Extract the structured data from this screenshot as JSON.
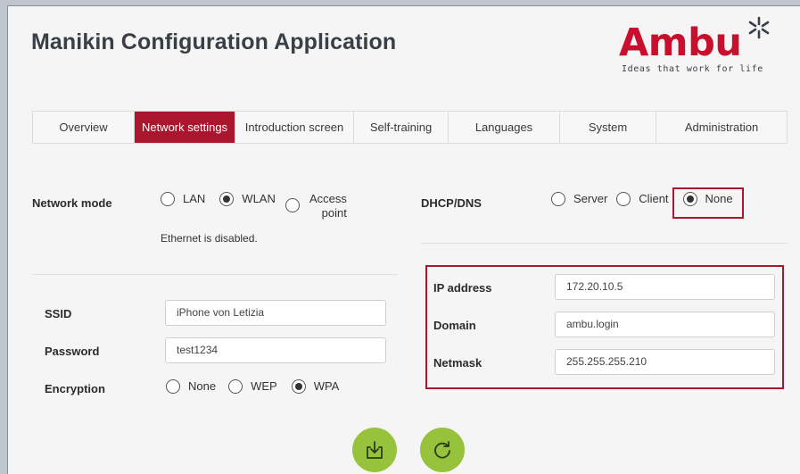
{
  "app": {
    "title": "Manikin Configuration Application",
    "brand": "Ambu",
    "tagline": "Ideas that work for life",
    "accent_color": "#a9162d",
    "action_color": "#97c23c"
  },
  "tabs": [
    {
      "label": "Overview",
      "active": false
    },
    {
      "label": "Network settings",
      "active": true
    },
    {
      "label": "Introduction screen",
      "active": false
    },
    {
      "label": "Self-training",
      "active": false
    },
    {
      "label": "Languages",
      "active": false
    },
    {
      "label": "System",
      "active": false
    },
    {
      "label": "Administration",
      "active": false
    }
  ],
  "network": {
    "mode_label": "Network mode",
    "modes": [
      {
        "label": "LAN",
        "checked": false
      },
      {
        "label": "WLAN",
        "checked": true
      },
      {
        "label": "Access point",
        "checked": false
      }
    ],
    "ethernet_note": "Ethernet is disabled."
  },
  "dhcp": {
    "label": "DHCP/DNS",
    "options": [
      {
        "label": "Server",
        "checked": false
      },
      {
        "label": "Client",
        "checked": false
      },
      {
        "label": "None",
        "checked": true
      }
    ]
  },
  "wlan": {
    "ssid_label": "SSID",
    "ssid_value": "iPhone von Letizia",
    "password_label": "Password",
    "password_value": "test1234",
    "encryption_label": "Encryption",
    "encryption_options": [
      {
        "label": "None",
        "checked": false
      },
      {
        "label": "WEP",
        "checked": false
      },
      {
        "label": "WPA",
        "checked": true
      }
    ]
  },
  "ip": {
    "ip_label": "IP address",
    "ip_value": "172.20.10.5",
    "domain_label": "Domain",
    "domain_value": "ambu.login",
    "netmask_label": "Netmask",
    "netmask_value": "255.255.255.210"
  },
  "actions": {
    "save_icon": "download-tray-icon",
    "reload_icon": "refresh-icon"
  }
}
